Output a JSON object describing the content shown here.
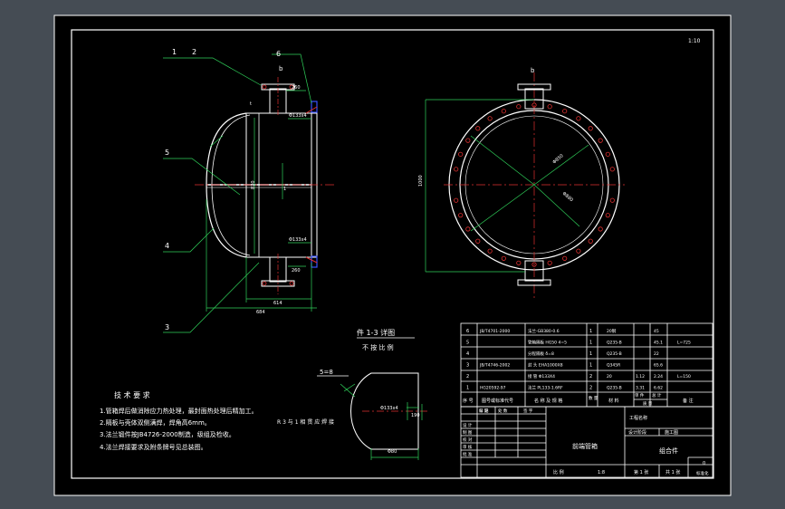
{
  "colors": {
    "line": "#ffffff",
    "green": "#2fd15a",
    "red": "#e03030",
    "yellow": "#e8e04a",
    "blue": "#3a52ff",
    "magenta": "#d040d0",
    "background": "#000000",
    "frame": "#454c54"
  },
  "callouts": {
    "c1": "1",
    "c2": "2",
    "c3": "3",
    "c4": "4",
    "c5": "5",
    "c6": "6",
    "b_top": "b",
    "b_right": "b",
    "b_bottom": "b",
    "t_mark": "t"
  },
  "dims": {
    "d260a": "260",
    "d13": "Φ133x4",
    "d1": "1",
    "d260b": "260",
    "d13b": "Φ133x4",
    "d614": "614",
    "d684": "684",
    "d870": "870",
    "dia1": "Φ850",
    "dia2": "Φ880",
    "dside": "1000"
  },
  "detail": {
    "title": "件 1-3  详图",
    "subtitle": "不 按 比 例",
    "eq": "5=8",
    "note": "R 3 与 1 相 贯 应 焊 接",
    "dim1": "Φ133x4",
    "dim2": "190",
    "dim3": "Φ80"
  },
  "tech": {
    "title": "技 术 要 求",
    "items": [
      "1.管箱焊后做消除应力热处理，最封面热处理后精加工。",
      "2.隔板与壳体双侧满焊，焊角高6mm。",
      "3.法兰锻件按JB4726-2000制造，级组及检收。",
      "4.法兰焊接要求及附条牌号见总装图。"
    ]
  },
  "corner": "1:10",
  "bom": {
    "rows": [
      {
        "no": "6",
        "code": "JB/T4701-2000",
        "name": "法兰-GB380-0.6",
        "qty": "1",
        "mat": "20钢",
        "w1": "",
        "w2": "45",
        "note": ""
      },
      {
        "no": "5",
        "code": "",
        "name": "管箱隔板 HG50 4=5",
        "qty": "1",
        "mat": "Q235-B",
        "w1": "",
        "w2": "45.1",
        "note": "L=725"
      },
      {
        "no": "4",
        "code": "",
        "name": "分程隔板 δ=8",
        "qty": "1",
        "mat": "Q235-B",
        "w1": "",
        "w2": "22",
        "note": ""
      },
      {
        "no": "3",
        "code": "JB/T4746-2002",
        "name": "封 头 EHA1000X8",
        "qty": "1",
        "mat": "Q345R",
        "w1": "",
        "w2": "65.6",
        "note": ""
      },
      {
        "no": "2",
        "code": "",
        "name": "接 管 Φ133X4",
        "qty": "2",
        "mat": "20",
        "w1": "1.12",
        "w2": "2.24",
        "note": "L=150"
      },
      {
        "no": "1",
        "code": "HG20592-97",
        "name": "法兰 PL133-1.6RF",
        "qty": "2",
        "mat": "Q235-B",
        "w1": "3.31",
        "w2": "6.62",
        "note": ""
      }
    ],
    "headers": {
      "no": "序 号",
      "code": "图号或标准代号",
      "name": "名 称 及 规 格",
      "qty": "数 量",
      "mat": "材 料",
      "w1": "单 件",
      "w2": "总 计",
      "weight": "质 量",
      "note": "备 注"
    }
  },
  "titleblock": {
    "project": "工程名称",
    "design_phase": "设计阶段",
    "stage_value": "施工图",
    "part_name": "前端管箱",
    "assembly": "组合件",
    "labels": [
      "标 记",
      "处 数",
      "签 字",
      "日 期"
    ],
    "roles": [
      "设 计",
      "制 图",
      "校 对",
      "审 核",
      "批 准"
    ],
    "scale_label": "比 例",
    "scale": "1:8",
    "sheet": "第 1 张",
    "total": "共 1 张",
    "ver": "0",
    "tag": "标准化"
  }
}
